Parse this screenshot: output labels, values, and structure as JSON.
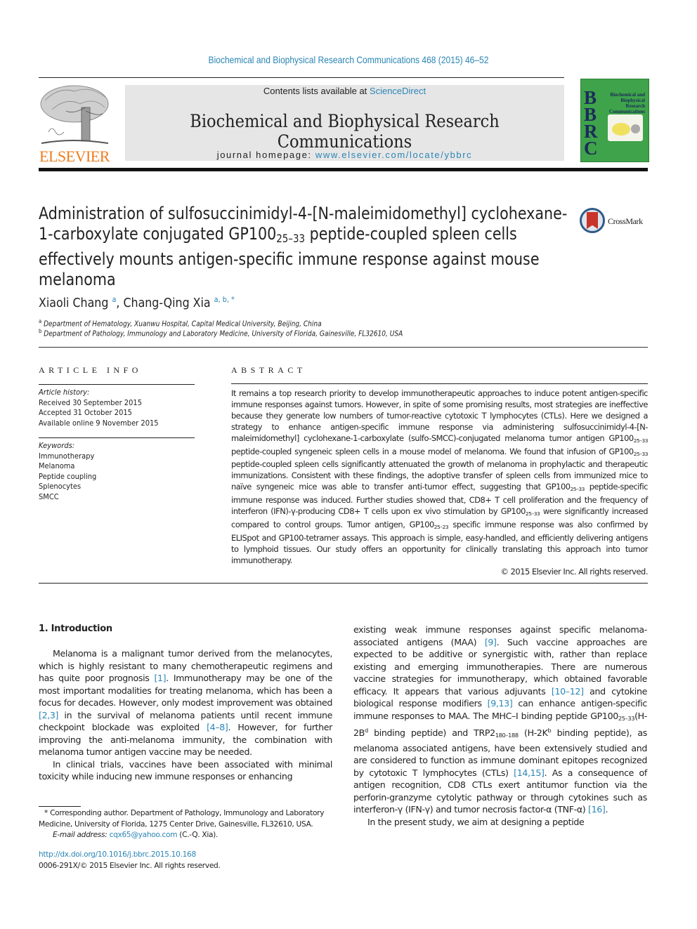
{
  "header": {
    "citation": "Biochemical and Biophysical Research Communications 468 (2015) 46–52",
    "publisher_logo": "ELSEVIER",
    "contents_prefix": "Contents lists available at ",
    "contents_link": "ScienceDirect",
    "journal_name": "Biochemical and Biophysical Research Communications",
    "homepage_prefix": "journal homepage: ",
    "homepage_link": "www.elsevier.com/locate/ybbrc",
    "cover": {
      "letters": [
        "B",
        "B",
        "R",
        "C"
      ],
      "title_lines": [
        "Biochemical and",
        "Biophysical",
        "Research",
        "Communications"
      ]
    },
    "colors": {
      "link": "#2a85b5",
      "elsevier_orange": "#f07c1d",
      "cover_green": "#3ea34a",
      "masthead_gray": "#e6e6e6"
    }
  },
  "article": {
    "title_part1": "Administration of sulfosuccinimidyl-4-[N-maleimidomethyl] cyclohexane-1-carboxylate conjugated GP100",
    "title_sub": "25–33",
    "title_part2": " peptide-coupled spleen cells effectively mounts antigen-specific immune response against mouse melanoma",
    "crossmark_label": "CrossMark",
    "authors": [
      {
        "name": "Xiaoli Chang",
        "marks": "a"
      },
      {
        "name": "Chang-Qing Xia",
        "marks": "a, b, *"
      }
    ],
    "affiliations": [
      {
        "mark": "a",
        "text": "Department of Hematology, Xuanwu Hospital, Capital Medical University, Beijing, China"
      },
      {
        "mark": "b",
        "text": "Department of Pathology, Immunology and Laboratory Medicine, University of Florida, Gainesville, FL32610, USA"
      }
    ]
  },
  "article_info": {
    "heading": "ARTICLE INFO",
    "history_label": "Article history:",
    "history": [
      "Received 30 September 2015",
      "Accepted 31 October 2015",
      "Available online 9 November 2015"
    ],
    "keywords_label": "Keywords:",
    "keywords": [
      "Immunotherapy",
      "Melanoma",
      "Peptide coupling",
      "Splenocytes",
      "SMCC"
    ]
  },
  "abstract": {
    "heading": "ABSTRACT",
    "segments": [
      "It remains a top research priority to develop immunotherapeutic approaches to induce potent antigen-specific immune responses against tumors. However, in spite of some promising results, most strategies are ineffective because they generate low numbers of tumor-reactive cytotoxic T lymphocytes (CTLs). Here we designed a strategy to enhance antigen-specific immune response via administering sulfosuccinimidyl-4-[N-maleimidomethyl] cyclohexane-1-carboxylate (sulfo-SMCC)-conjugated melanoma tumor antigen GP100",
      "25–33",
      " peptide-coupled syngeneic spleen cells in a mouse model of melanoma. We found that infusion of GP100",
      "25–33",
      " peptide-coupled spleen cells significantly attenuated the growth of melanoma in prophylactic and therapeutic immunizations. Consistent with these findings, the adoptive transfer of spleen cells from immunized mice to naïve syngeneic mice was able to transfer anti-tumor effect, suggesting that GP100",
      "25–33",
      " peptide-specific immune response was induced. Further studies showed that, CD8+ T cell proliferation and the frequency of interferon (IFN)-γ-producing CD8+ T cells upon ex vivo stimulation by GP100",
      "25–33",
      " were significantly increased compared to control groups. Tumor antigen, GP100",
      "25–23",
      " specific immune response was also confirmed by ELISpot and GP100-tetramer assays. This approach is simple, easy-handled, and efficiently delivering antigens to lymphoid tissues. Our study offers an opportunity for clinically translating this approach into tumor immunotherapy."
    ],
    "copyright": "© 2015 Elsevier Inc. All rights reserved."
  },
  "introduction": {
    "heading": "1.  Introduction",
    "left": {
      "p1": [
        "Melanoma is a malignant tumor derived from the melanocytes, which is highly resistant to many chemotherapeutic regimens and has quite poor prognosis ",
        "[1]",
        ". Immunotherapy may be one of the most important modalities for treating melanoma, which has been a focus for decades. However, only modest improvement was obtained ",
        "[2,3]",
        " in the survival of melanoma patients until recent immune checkpoint blockade was exploited ",
        "[4–8]",
        ". However, for further improving the anti-melanoma immunity, the combination with melanoma tumor antigen vaccine may be needed."
      ],
      "p2": "In clinical trials, vaccines have been associated with minimal toxicity while inducing new immune responses or enhancing"
    },
    "right": {
      "p1": [
        "existing weak immune responses against specific melanoma-associated antigens (MAA) ",
        "[9]",
        ". Such vaccine approaches are expected to be additive or synergistic with, rather than replace existing and emerging immunotherapies. There are numerous vaccine strategies for immunotherapy, which obtained favorable efficacy. It appears that various adjuvants ",
        "[10–12]",
        " and cytokine biological response modifiers ",
        "[9,13]",
        " can enhance antigen-specific immune responses to MAA. The MHC–I binding peptide GP100",
        "25–33",
        "(H-2B",
        "d",
        " binding peptide) and TRP2",
        "180–188",
        " (H-2K",
        "b",
        " binding peptide), as melanoma associated antigens, have been extensively studied and are considered to function as immune dominant epitopes recognized by cytotoxic T lymphocytes (CTLs) ",
        "[14,15]",
        ". As a consequence of antigen recognition, CD8 CTLs exert antitumor function via the perforin-granzyme cytolytic pathway or through cytokines such as interferon-γ (IFN-γ) and tumor necrosis factor-α (TNF-α) ",
        "[16]",
        "."
      ],
      "p2": "In the present study, we aim at designing a peptide"
    }
  },
  "footnotes": {
    "corresponding": "* Corresponding author. Department of Pathology, Immunology and Laboratory Medicine, University of Florida, 1275 Center Drive, Gainesville, FL32610, USA.",
    "email_label": "E-mail address: ",
    "email": "cqx65@yahoo.com",
    "email_suffix": " (C.-Q. Xia).",
    "doi": "http://dx.doi.org/10.1016/j.bbrc.2015.10.168",
    "issn": "0006-291X/© 2015 Elsevier Inc. All rights reserved."
  }
}
